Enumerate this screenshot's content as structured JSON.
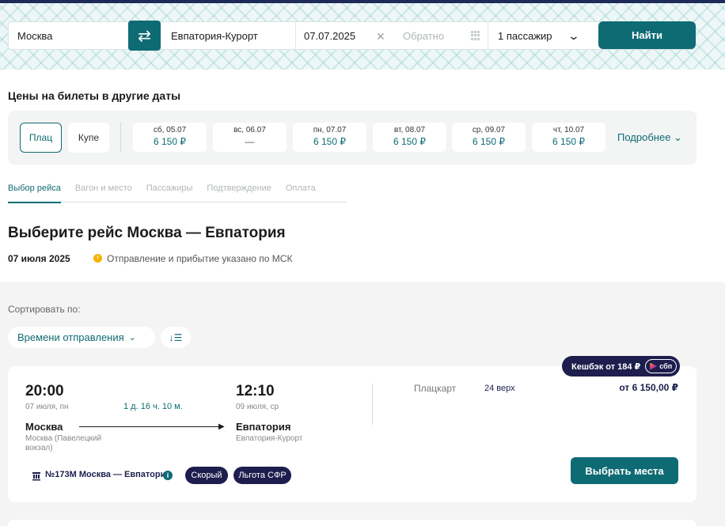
{
  "search": {
    "from": "Москва",
    "to": "Евпатория-Курорт",
    "date": "07.07.2025",
    "return_placeholder": "Обратно",
    "passengers": "1 пассажир",
    "find_label": "Найти"
  },
  "prices": {
    "heading": "Цены на билеты в другие даты",
    "classes": [
      "Плац",
      "Купе"
    ],
    "dates": [
      {
        "day": "сб, 05.07",
        "price": "6 150 ₽"
      },
      {
        "day": "вс, 06.07",
        "price": "—"
      },
      {
        "day": "пн, 07.07",
        "price": "6 150 ₽"
      },
      {
        "day": "вт, 08.07",
        "price": "6 150 ₽"
      },
      {
        "day": "ср, 09.07",
        "price": "6 150 ₽"
      },
      {
        "day": "чт, 10.07",
        "price": "6 150 ₽"
      }
    ],
    "more": "Подробнее"
  },
  "steps": [
    "Выбор рейса",
    "Вагон и место",
    "Пассажиры",
    "Подтверждение",
    "Оплата"
  ],
  "main": {
    "title": "Выберите рейс Москва — Евпатория",
    "date": "07 июля 2025",
    "tz_note": "Отправление и прибытие указано по МСК"
  },
  "sort": {
    "label": "Сортировать по:",
    "selected": "Времени отправления",
    "order_icon": "↓☰"
  },
  "trip": {
    "cashback": "Кешбэк от 184 ₽",
    "sbp": "сбп",
    "dep_time": "20:00",
    "dep_date": "07 июля, пн",
    "duration": "1 д. 16 ч. 10 м.",
    "arr_time": "12:10",
    "arr_date": "09 июля, ср",
    "from_city": "Москва",
    "from_station": "Москва (Павелецкий вокзал)",
    "to_city": "Евпатория",
    "to_station": "Евпатория-Курорт",
    "car_class": "Плацкарт",
    "seats": "24 верх",
    "price": "от 6 150,00 ₽",
    "train": "№173М Москва — Евпатория",
    "badges": [
      "Скорый",
      "Льгота СФР"
    ],
    "select_label": "Выбрать места"
  },
  "colors": {
    "accent": "#0e6b73",
    "navy": "#1d1e4d",
    "clock": "#f5b400"
  }
}
